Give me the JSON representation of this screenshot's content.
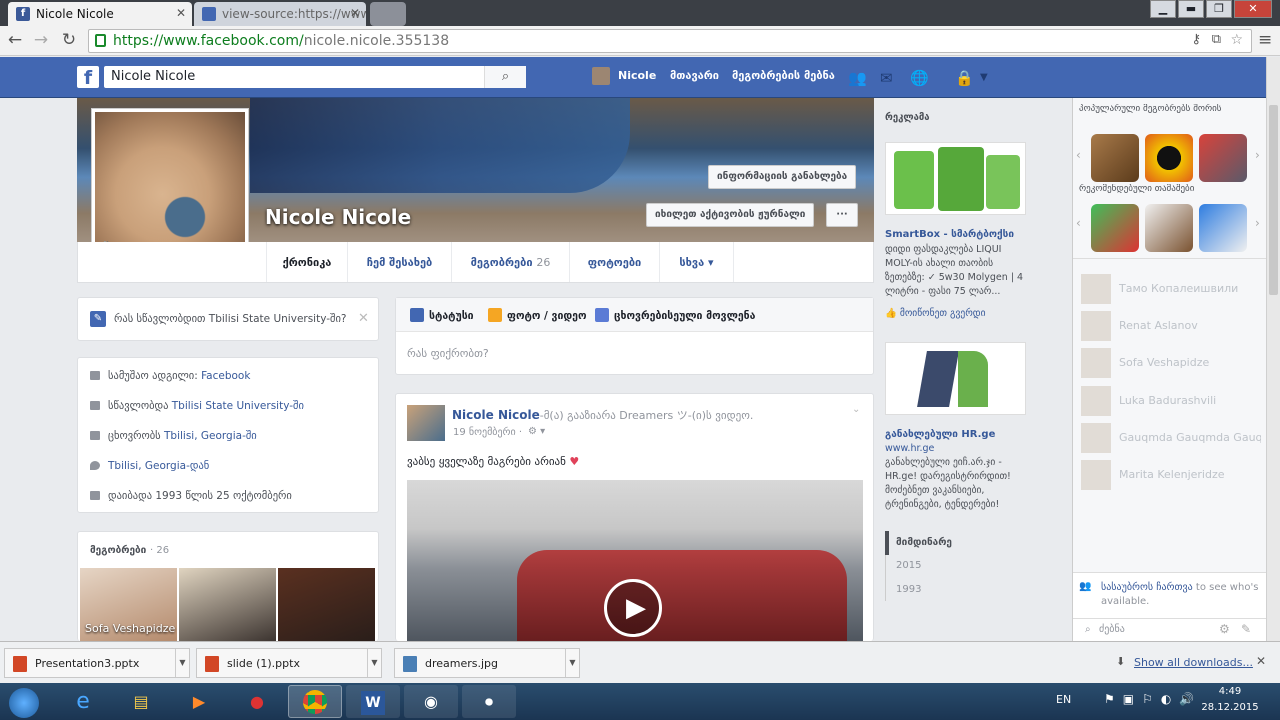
{
  "browser": {
    "tabs": [
      {
        "title": "Nicole Nicole",
        "favicon": "f"
      },
      {
        "title": "view-source:https://www.f",
        "favicon": ""
      }
    ],
    "url_host": "https://www.facebook.com/",
    "url_path": "nicole.nicole.355138"
  },
  "fb": {
    "logo": "f",
    "search_value": "Nicole Nicole",
    "nav": {
      "profile": "Nicole",
      "home": "მთავარი",
      "find_friends": "მეგობრების მებნა"
    }
  },
  "profile": {
    "name": "Nicole Nicole",
    "cover_buttons": {
      "update_info": "ინფორმაციის განახლება",
      "activity_log": "იხილეთ აქტივობის ჟურნალი",
      "more": "···"
    },
    "tabs": [
      {
        "label": "ქრონიკა"
      },
      {
        "label": "ჩემ შესახებ"
      },
      {
        "label": "მეგობრები",
        "count": "26"
      },
      {
        "label": "ფოტოები"
      },
      {
        "label": "სხვა ▾"
      }
    ]
  },
  "left": {
    "prompt": "რას სწავლობდით Tbilisi State University-ში?",
    "intro": [
      {
        "text": "სამუშაო ადგილი: ",
        "link": "Facebook"
      },
      {
        "text": "სწავლობდა ",
        "link": "Tbilisi State University-ში"
      },
      {
        "text": "ცხოვრობს ",
        "link": "Tbilisi, Georgia-ში"
      },
      {
        "text": "",
        "link": "Tbilisi, Georgia-დან"
      },
      {
        "text": "დაიბადა 1993 წლის 25 ოქტომბერი",
        "link": ""
      }
    ],
    "friends_title": "მეგობრები",
    "friends_count": "· 26",
    "friends": [
      {
        "name": "Sofa Veshapidze"
      },
      {
        "name": ""
      },
      {
        "name": ""
      }
    ]
  },
  "composer": {
    "status": "სტატუსი",
    "photo": "ფოტო / ვიდეო",
    "life_event": "ცხოვრებისეული მოვლენა",
    "placeholder": "რას ფიქრობთ?"
  },
  "post": {
    "author": "Nicole Nicole",
    "action": "-მ(ა) გააზიარა Dreamers",
    "action_tail": " ツ-(ი)ს ვიდეო.",
    "date": "19 ნოემბერი · ",
    "text": "ვაბსე ყველაზე მაგრები არიან",
    "heart": "♥"
  },
  "ads": {
    "header": "რეკლამა",
    "ad1": {
      "title": "SmartBox - სმარტბოქსი",
      "body": "დიდი ფასდაკლება LIQUI MOLY-ის ახალი თაობის ზეთებზე: ✓ 5w30 Molygen | 4 ლიტრი - ფასი 75 ლარ...",
      "like": "მოიწონეთ გვერდი"
    },
    "ad2": {
      "title": "განახლებული HR.ge",
      "url": "www.hr.ge",
      "body": "განახლებული ეიჩ.არ.ჯი - HR.ge! დარეგისტრირდით! მოძებნეთ ვაკანსიები, ტრენინგები, ტენდერები!"
    },
    "years": [
      "მიმდინარე",
      "2015",
      "1993"
    ]
  },
  "chat": {
    "popular_games": "პოპულარული მეგობრებს შორის",
    "recommended": "რეკომენდებული თამაშები",
    "people": [
      "Тамо Копалеишвили",
      "Renat Aslanov",
      "Sofa Veshapidze",
      "Luka Badurashvili",
      "Gauqmda Gauqmda Gauq...",
      "Marita Kelenjeridze"
    ],
    "turn_on": "სასაუბროს ჩართვა",
    "turn_on_tail": " to see who's available.",
    "search_placeholder": "ძებნა"
  },
  "downloads": {
    "items": [
      "Presentation3.pptx",
      "slide (1).pptx",
      "dreamers.jpg"
    ],
    "show_all": "Show all downloads..."
  },
  "taskbar": {
    "lang": "EN",
    "time": "4:49",
    "date": "28.12.2015"
  },
  "colors": {
    "fb_blue": "#4267b2",
    "link": "#365899"
  }
}
